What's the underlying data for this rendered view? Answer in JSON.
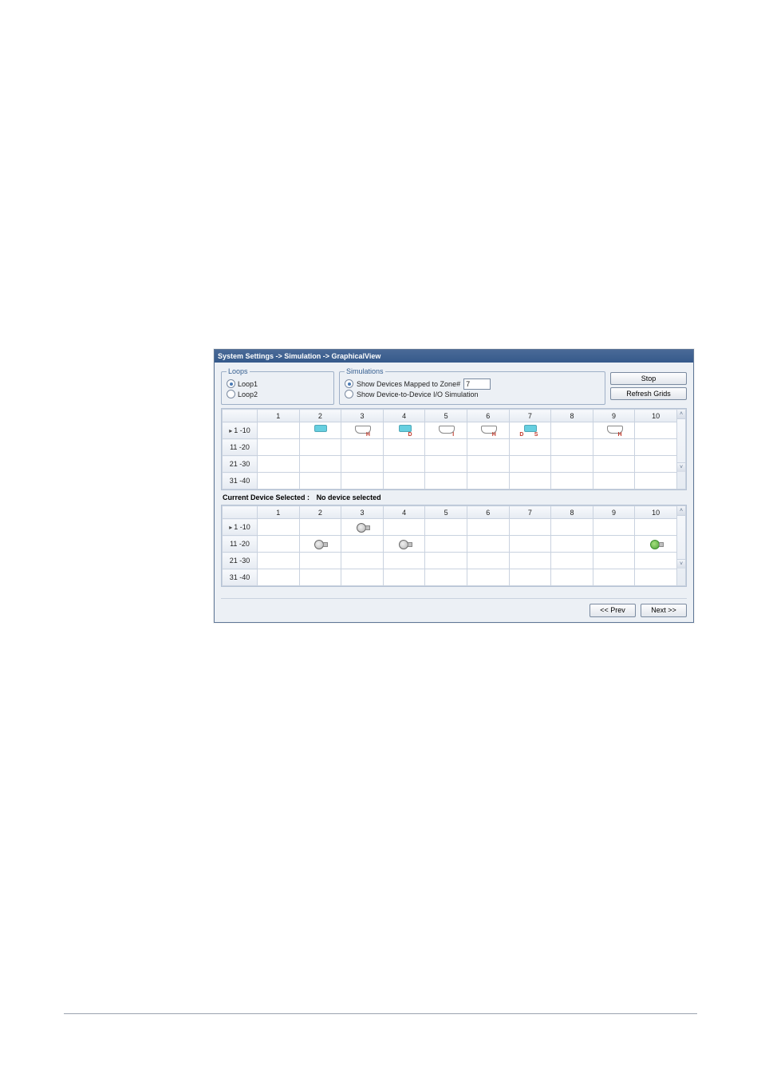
{
  "titlebar": "System Settings -> Simulation -> GraphicalView",
  "loops": {
    "legend": "Loops",
    "items": [
      {
        "label": "Loop1",
        "checked": true
      },
      {
        "label": "Loop2",
        "checked": false
      }
    ]
  },
  "simulations": {
    "legend": "Simulations",
    "opt_zone": {
      "label": "Show Devices Mapped to Zone#",
      "checked": true,
      "value": "7"
    },
    "opt_io": {
      "label": "Show Device-to-Device I/O Simulation",
      "checked": false
    }
  },
  "buttons": {
    "stop": "Stop",
    "refresh": "Refresh Grids",
    "prev": "<< Prev",
    "next": "Next >>"
  },
  "grid_columns": [
    "1",
    "2",
    "3",
    "4",
    "5",
    "6",
    "7",
    "8",
    "9",
    "10"
  ],
  "grid1_rows": [
    "1 -10",
    "11 -20",
    "21 -30",
    "31 -40"
  ],
  "grid2_rows": [
    "1 -10",
    "11 -20",
    "21 -30",
    "31 -40"
  ],
  "selected_device": {
    "label": "Current Device Selected :",
    "value": "No device selected"
  },
  "grid1_devices_row1": {
    "2": {
      "type": "detector",
      "cyan": true,
      "letter": ""
    },
    "3": {
      "type": "base",
      "letter": "H"
    },
    "4": {
      "type": "detector",
      "cyan": true,
      "letter": "D"
    },
    "5": {
      "type": "base",
      "letter": "I"
    },
    "6": {
      "type": "base",
      "letter": "H"
    },
    "7": {
      "type": "detector",
      "cyan": true,
      "letter": "S",
      "leftletter": "D"
    },
    "9": {
      "type": "base",
      "letter": "H"
    }
  },
  "grid2_devices": {
    "r1": {
      "3": {
        "type": "sounder",
        "green": false
      }
    },
    "r2": {
      "2": {
        "type": "sounder",
        "green": false
      },
      "4": {
        "type": "sounder",
        "green": false
      },
      "10": {
        "type": "sounder",
        "green": true
      }
    }
  }
}
